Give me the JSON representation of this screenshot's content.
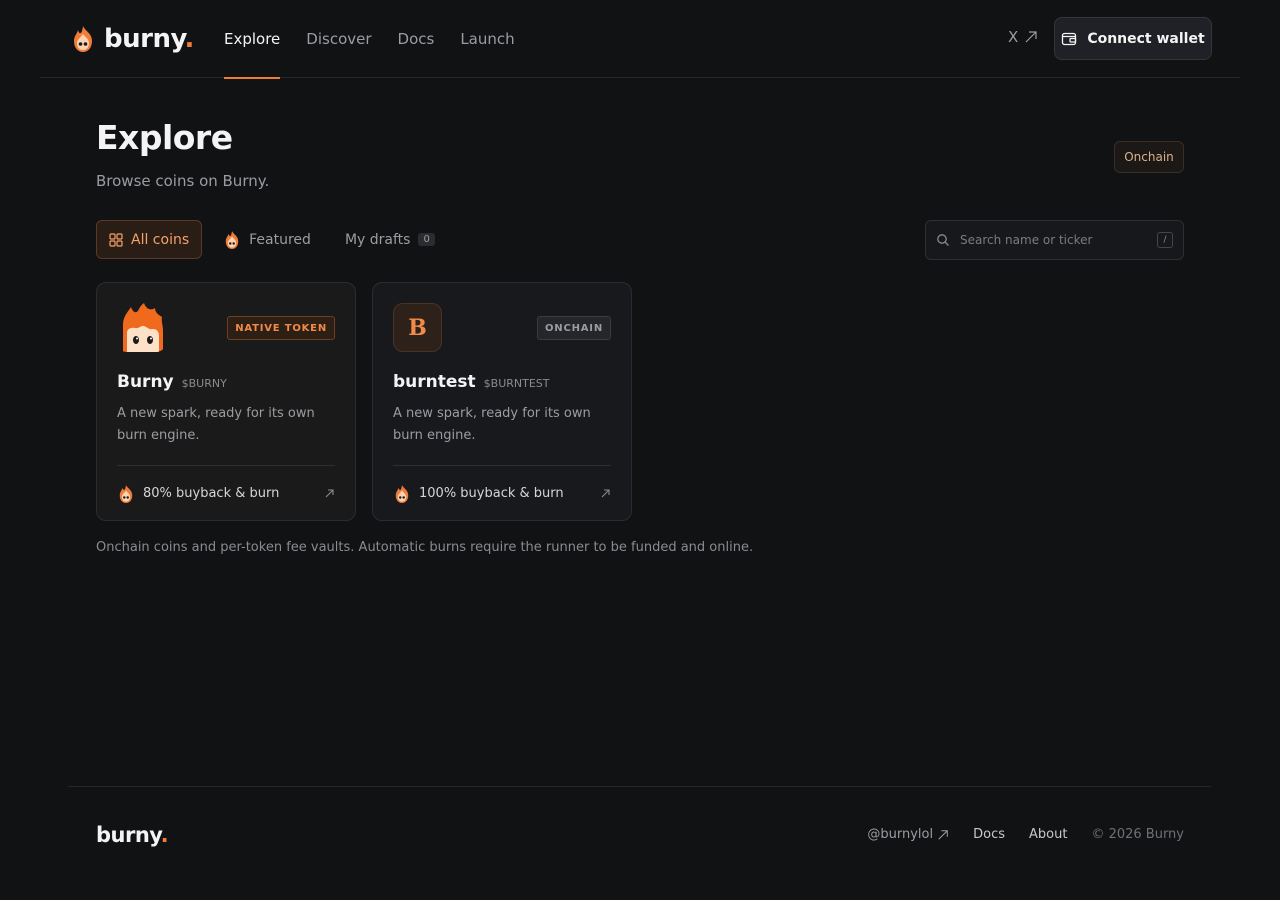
{
  "colors": {
    "accent": "#f07c3a",
    "background": "#111214",
    "card": "#18191d"
  },
  "header": {
    "logo_text": "burny",
    "logo_dot": ".",
    "nav": [
      {
        "label": "Explore",
        "active": true
      },
      {
        "label": "Discover"
      },
      {
        "label": "Docs"
      },
      {
        "label": "Launch"
      }
    ],
    "x_link": "X",
    "connect_label": "Connect wallet"
  },
  "page": {
    "title": "Explore",
    "subtitle": "Browse coins on Burny.",
    "badge": "Onchain"
  },
  "tabs": {
    "all": "All coins",
    "featured": "Featured",
    "drafts": "My drafts",
    "drafts_count": "0"
  },
  "search": {
    "placeholder": "Search name or ticker",
    "shortcut": "/"
  },
  "cards": [
    {
      "name": "Burny",
      "ticker": "$BURNY",
      "tag": "NATIVE TOKEN",
      "description": "A new spark, ready for its own burn engine.",
      "footer": "80% buyback & burn",
      "avatar": "flame-mascot"
    },
    {
      "name": "burntest",
      "ticker": "$BURNTEST",
      "tag": "ONCHAIN",
      "description": "A new spark, ready for its own burn engine.",
      "footer": "100% buyback & burn",
      "avatar_letter": "B"
    }
  ],
  "note": "Onchain coins and per-token fee vaults. Automatic burns require the runner to be funded and online.",
  "footer": {
    "logo_text": "burny",
    "logo_dot": ".",
    "twitter": "@burnylol",
    "docs": "Docs",
    "about": "About",
    "copyright": "© 2026 Burny"
  }
}
